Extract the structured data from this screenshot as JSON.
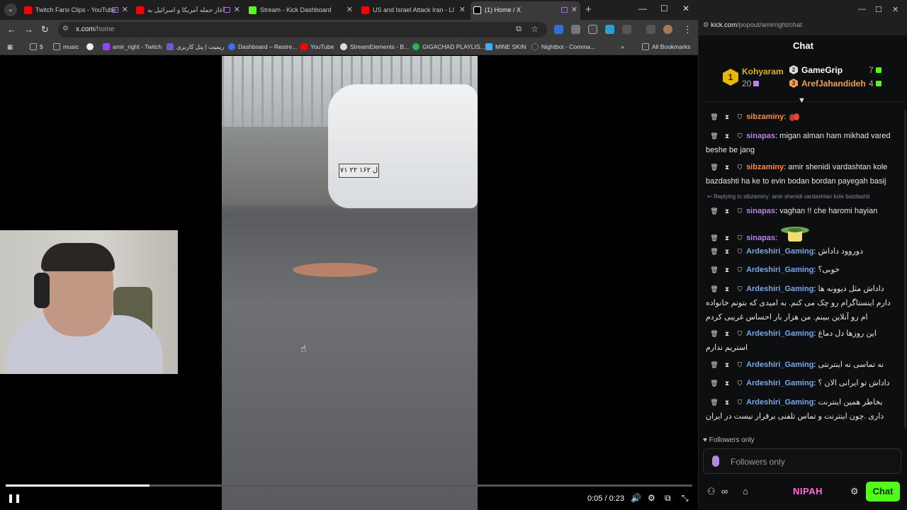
{
  "browser": {
    "tabs": [
      {
        "label": "Twitch Farsi Clips - YouTube",
        "favicon_color": "#ff0000"
      },
      {
        "label": "آغاز حمله آمریکا و اسرائیل به",
        "favicon_color": "#ff0000"
      },
      {
        "label": "Stream - Kick Dashboard",
        "favicon_color": "#53fc18"
      },
      {
        "label": "US and Israel Attack Iran - LIVE",
        "favicon_color": "#ff0000"
      },
      {
        "label": "(1) Home / X",
        "favicon_color": "#ffffff"
      }
    ],
    "new_tab": "+",
    "url_host": "x.com",
    "url_path": "/home",
    "bookmarks": [
      {
        "label": "$",
        "color": "#8a8a8a"
      },
      {
        "label": "music",
        "color": "#8a8a8a"
      },
      {
        "label": "amir_right - Twitch",
        "color": "#9146ff"
      },
      {
        "label": "ریمیت | پنل کاربری",
        "color": "#6a5acd"
      },
      {
        "label": "Dashboard – Restre...",
        "color": "#3b6ef5"
      },
      {
        "label": "YouTube",
        "color": "#ff0000"
      },
      {
        "label": "StreamElements - B...",
        "color": "#dddddd"
      },
      {
        "label": "GIGACHAD PLAYLIS...",
        "color": "#1db954"
      },
      {
        "label": "MINE SKIN",
        "color": "#44aaff"
      },
      {
        "label": "Nightbot - Comma...",
        "color": "#333333"
      }
    ],
    "all_bookmarks": "All Bookmarks"
  },
  "video": {
    "plate_text": "۷۱ ل ۱۶۲ ۲۲",
    "time": "0:05 / 0:23",
    "progress": 0.21
  },
  "chat": {
    "address_host": "kick.com",
    "address_path": "/popout/amirright/chat",
    "title": "Chat",
    "leaders": [
      {
        "rank": "1",
        "name": "Kohyaram",
        "count": "20",
        "color": "#e0b020"
      },
      {
        "rank": "2",
        "name": "GameGrip",
        "count": "7",
        "color": "#ffffff"
      },
      {
        "rank": "3",
        "name": "ArefJahandideh",
        "count": "4",
        "color": "#f0a050"
      }
    ],
    "messages": [
      {
        "user": "sibzaminy",
        "text": "",
        "color": "#ff8a3d"
      },
      {
        "user": "sinapas",
        "text": " migan alman ham mikhad vared beshe be jang",
        "color": "#b784e8"
      },
      {
        "user": "sibzaminy",
        "text": " amir shenidi vardashtan kole bazdashti ha ke to evin bodan bordan payegah basij",
        "color": "#ff8a3d"
      },
      {
        "user": "sinapas",
        "text": " vaghan !! che haromi hayian",
        "color": "#b784e8"
      },
      {
        "user": "sinapas",
        "text": "",
        "color": "#b784e8"
      },
      {
        "user": "Ardeshiri_Gaming",
        "text": " دوروود داداش",
        "color": "#7aa7e8"
      },
      {
        "user": "Ardeshiri_Gaming",
        "text": " خوبی؟",
        "color": "#7aa7e8"
      },
      {
        "user": "Ardeshiri_Gaming",
        "text": " داداش مثل دیوونه ها دارم اینستاگرام رو چک می کنم. به امیدی که بتونم خانواده ام رو آنلاین ببینم. من هزار بار احساس غریبی کردم",
        "color": "#7aa7e8"
      },
      {
        "user": "Ardeshiri_Gaming",
        "text": " این روزها دل دماغ استریم ندارم",
        "color": "#7aa7e8"
      },
      {
        "user": "Ardeshiri_Gaming",
        "text": " نه تماسی نه اینترنتی",
        "color": "#7aa7e8"
      },
      {
        "user": "Ardeshiri_Gaming",
        "text": " داداش تو ایرانی الان ؟",
        "color": "#7aa7e8"
      },
      {
        "user": "Ardeshiri_Gaming",
        "text": " بخاطر همین اینترنت داری .چون اینترنت و تماس تلفنی برقرار نیست در ایران",
        "color": "#7aa7e8"
      }
    ],
    "reply_note": "Replying to sibzaminy: amir shenidi vardashtan kole bazdashti",
    "followers_only_label": "Followers only",
    "input_placeholder": "Followers only",
    "footer_badge": "NIPAH",
    "chat_button": "Chat"
  }
}
